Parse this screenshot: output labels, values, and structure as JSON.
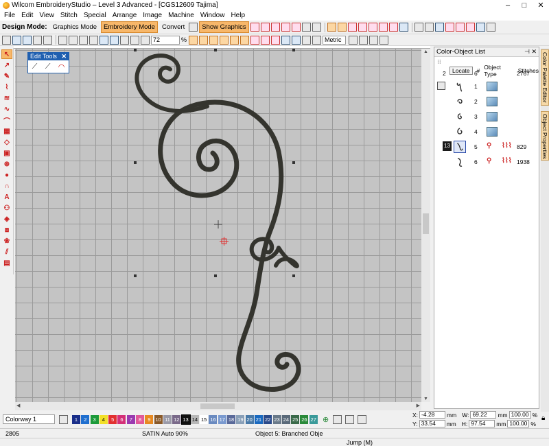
{
  "window": {
    "title": "Wilcom EmbroideryStudio – Level 3 Advanced - [CGS12609 Tajima]",
    "controls": [
      "–",
      "□",
      "✕"
    ]
  },
  "menu": [
    "File",
    "Edit",
    "View",
    "Stitch",
    "Special",
    "Arrange",
    "Image",
    "Machine",
    "Window",
    "Help"
  ],
  "toolbar": {
    "design_mode_label": "Design Mode:",
    "graphics_mode": "Graphics Mode",
    "embroidery_mode": "Embroidery Mode",
    "convert": "Convert",
    "show_graphics": "Show Graphics",
    "zoom_value": "72",
    "zoom_unit": "%",
    "units": "Metric"
  },
  "edit_tools": {
    "title": "Edit Tools",
    "close": "✕"
  },
  "panel": {
    "title": "Color-Object List",
    "locate_label": "Locate",
    "col_number": "#",
    "col_object_type": "Object Type",
    "col_stitches": "Stitches",
    "summary": {
      "colors": "2",
      "objects": "6",
      "stitches": "2767"
    },
    "rows": [
      {
        "num": "1",
        "stitches": ""
      },
      {
        "num": "2",
        "stitches": ""
      },
      {
        "num": "3",
        "stitches": ""
      },
      {
        "num": "4",
        "stitches": ""
      },
      {
        "num": "5",
        "stitches": "829",
        "color": "13"
      },
      {
        "num": "6",
        "stitches": "1938"
      }
    ]
  },
  "side_tabs": [
    "Color Palette Editor",
    "Object Properties"
  ],
  "colorbar": {
    "colorway": "Colorway 1",
    "swatches": [
      {
        "n": "1",
        "c": "#1a2f8a"
      },
      {
        "n": "2",
        "c": "#1f6fcf"
      },
      {
        "n": "3",
        "c": "#1c9a3a"
      },
      {
        "n": "4",
        "c": "#f2e028"
      },
      {
        "n": "5",
        "c": "#e23030"
      },
      {
        "n": "6",
        "c": "#d43078"
      },
      {
        "n": "7",
        "c": "#9a3ab0"
      },
      {
        "n": "8",
        "c": "#e25a9a"
      },
      {
        "n": "9",
        "c": "#e88a22"
      },
      {
        "n": "10",
        "c": "#8a5a2a"
      },
      {
        "n": "11",
        "c": "#9a9aa8"
      },
      {
        "n": "12",
        "c": "#7a6a8a"
      },
      {
        "n": "13",
        "c": "#111111"
      },
      {
        "n": "14",
        "c": "#b8b8b8"
      },
      {
        "n": "15",
        "c": "#ffffff"
      },
      {
        "n": "16",
        "c": "#6a8ac0"
      },
      {
        "n": "17",
        "c": "#7a9ad0"
      },
      {
        "n": "18",
        "c": "#5a6a9a"
      },
      {
        "n": "19",
        "c": "#8aa0b8"
      },
      {
        "n": "20",
        "c": "#4a7aa8"
      },
      {
        "n": "21",
        "c": "#1a6ac0"
      },
      {
        "n": "22",
        "c": "#2a4a8a"
      },
      {
        "n": "23",
        "c": "#6a7a8a"
      },
      {
        "n": "24",
        "c": "#5a6a7a"
      },
      {
        "n": "25",
        "c": "#3a6a4a"
      },
      {
        "n": "26",
        "c": "#2a8a3a"
      },
      {
        "n": "27",
        "c": "#3a9a9a"
      }
    ]
  },
  "coords": {
    "x_label": "X:",
    "x": "-4.28",
    "y_label": "Y:",
    "y": "33.54",
    "w_label": "W:",
    "w": "69.22",
    "h_label": "H:",
    "h": "97.54",
    "unit": "mm",
    "w_pct": "100.00",
    "h_pct": "100.00",
    "pct": "%"
  },
  "status": {
    "stitch_count": "2805",
    "stitch_type": "SATIN Auto 90%",
    "object": "Object 5: Branched Obje",
    "jump": "Jump (M)"
  },
  "colors": {
    "accent": "#f7b76a",
    "thread": "#3a3a34",
    "canvas": "#c4c4c4"
  }
}
